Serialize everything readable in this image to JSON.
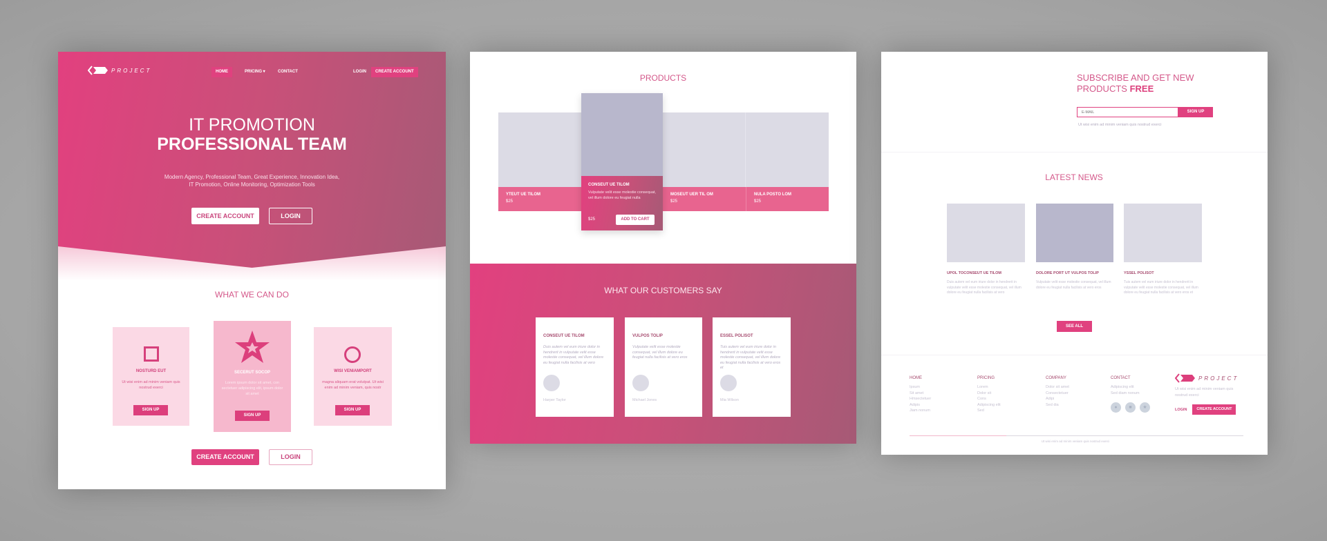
{
  "colors": {
    "accent": "#e0417f",
    "gradient_end": "#a65a76",
    "placeholder_gray": "#dcdbe5",
    "placeholder_dark": "#b8b7cc"
  },
  "landing": {
    "logo": "PROJECT",
    "nav": {
      "home": "HOME",
      "pricing": "PRICING ▾",
      "contact": "CONTACT",
      "login": "LOGIN",
      "create_account": "CREATE ACCOUNT"
    },
    "hero": {
      "title_line1": "IT PROMOTION",
      "title_line2": "PROFESSIONAL TEAM",
      "subtitle_line1": "Modern Agency, Professional Team, Great Experience, Innovation Idea,",
      "subtitle_line2": "IT Promotion, Online Monitoring, Optimization Tools",
      "create_account": "CREATE ACCOUNT",
      "login": "LOGIN"
    },
    "services": {
      "title": "WHAT WE CAN DO",
      "cards": [
        {
          "icon": "square-icon",
          "title": "NOSTURD EUT",
          "text": "Ut wisi enim ad minim veniam quis nostrud exerci",
          "button": "SIGN UP"
        },
        {
          "icon": "star-icon",
          "title": "SECERUT SOCOP",
          "text": "Lorem ipsum dolor sit amet, con sectetuer adipiscing elit, ipsum dolor sit amet",
          "button": "SIGN UP"
        },
        {
          "icon": "circle-icon",
          "title": "WISI VENIAMPORT",
          "text": "magna aliquam erat volutpat. Ut wisi enim ad minim veniam, quis nostr",
          "button": "SIGN UP"
        }
      ]
    },
    "bottom": {
      "create_account": "CREATE ACCOUNT",
      "login": "LOGIN"
    }
  },
  "shop": {
    "products_title": "PRODUCTS",
    "products": [
      {
        "name": "YTEUT UE TILOM",
        "price": "$25"
      },
      {
        "name": "CONSEUT UE TILOM",
        "price": "$25",
        "text": "Vulputate velit esse molestie consequat, vel illum dolore eu feugiat nulla",
        "button": "ADD TO CART"
      },
      {
        "name": "MOSEUT UER TIL OM",
        "price": "$25"
      },
      {
        "name": "NULA POSTO LOM",
        "price": "$25"
      }
    ],
    "testimonials_title": "WHAT OUR CUSTOMERS SAY",
    "testimonials": [
      {
        "title": "CONSEUT UE TILOM",
        "text": "Duis autem vel eum iriure dolor in hendrerit in vulputate velit esse molestie consequat, vel illum dolore eu feugiat nulla facilisis at vero",
        "name": "Harper Taylor"
      },
      {
        "title": "VULPOS TOLIP",
        "text": "Vulputate velit esse molestie consequat, vel illum dolore eu feugiat nulla facilisis at vero eros",
        "name": "Michael Jones"
      },
      {
        "title": "ESSEL POLISOT",
        "text": "Tuis autem vel eum iriure dolor in hendrerit in vulputate velit esse molestie consequat, vel illum dolore eu feugiat nulla facilisis at vero eros et",
        "name": "Mia Wilson"
      }
    ]
  },
  "news_page": {
    "subscribe": {
      "title_line1": "SUBSCRIBE AND GET NEW",
      "title_line2": "PRODUCTS ",
      "title_bold": "FREE",
      "placeholder": "E-MAIL",
      "button": "SIGN UP",
      "note": "Ut wisi enim ad minim veniam quis nostrud exerci"
    },
    "news_title": "LATEST NEWS",
    "news": [
      {
        "title": "UPOL TOCONSEUT UE TILOM",
        "text": "Duis autem vel eum iriure dolor in hendrerit in vulputate velit esse molestie consequat, vel illum dolore eu feugiat nulla facilisis at vero"
      },
      {
        "title": "DOLORE PORT UT VULPOS TOLIP",
        "text": "Vulputate velit esse molestie consequat, vel illum dolore eu feugiat nulla facilisis at vero eros"
      },
      {
        "title": "YSSEL POLISOT",
        "text": "Tuis autem vel eum iriure dolor in hendrerit in vulputate velit esse molestie consequat, vel illum dolore eu feugiat nulla facilisis at vero eros et"
      }
    ],
    "see_all": "SEE ALL",
    "footer": {
      "cols": [
        {
          "title": "HOME",
          "links": [
            "Ipsum",
            "Sit amet",
            "Hmsectetuer",
            "Adipis",
            "Jiam nonum"
          ]
        },
        {
          "title": "PRICING",
          "links": [
            "Lorem",
            "Dolor sit",
            "Cons",
            "Adipiscing elit",
            "Sed"
          ]
        },
        {
          "title": "COMPANY",
          "links": [
            "Dolor sit amet",
            "Consectetuer",
            "Adipi",
            "Sed dia"
          ]
        },
        {
          "title": "CONTACT",
          "links": [
            "Adipiscing elit",
            "Sed diam nonum"
          ]
        }
      ],
      "social_icons": [
        "dot-icon",
        "square-icon",
        "star-icon"
      ],
      "logo": "PROJECT",
      "about": "Ut wisi enim ad minim veniam quis nostrud exerci",
      "login": "LOGIN",
      "create_account": "CREATE ACCOUNT",
      "copyright": "Ut wisi enim ad minim veniam quis nostrud exerci"
    }
  }
}
